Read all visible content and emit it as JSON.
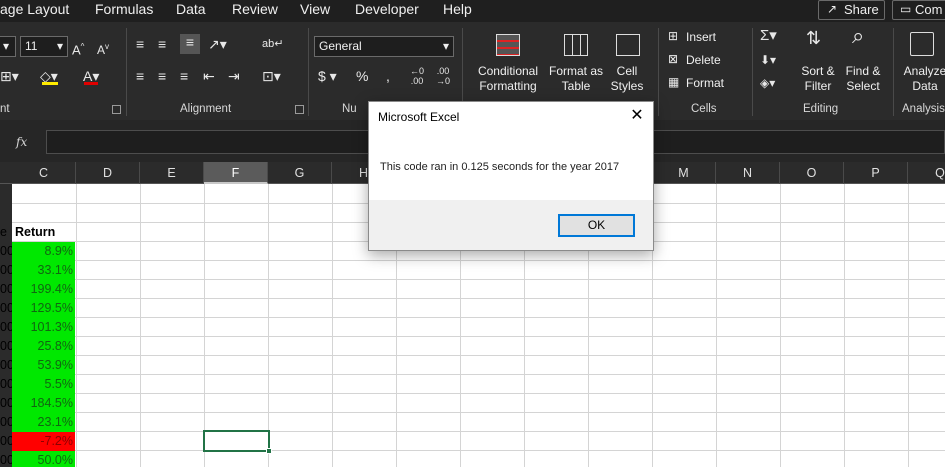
{
  "menu": {
    "items": [
      "age Layout",
      "Formulas",
      "Data",
      "Review",
      "View",
      "Developer",
      "Help"
    ],
    "share_label": "Share",
    "comments_label": "Com"
  },
  "ribbon": {
    "font_size": "11",
    "number_format": "General",
    "groups": {
      "font": "nt",
      "alignment": "Alignment",
      "number": "Nu",
      "cells": "Cells",
      "editing": "Editing",
      "analysis": "Analysis"
    },
    "conditional_formatting": [
      "Conditional",
      "Formatting"
    ],
    "format_as_table": [
      "Format as",
      "Table"
    ],
    "cell_styles": [
      "Cell",
      "Styles"
    ],
    "insert_label": "Insert",
    "delete_label": "Delete",
    "format_label": "Format",
    "sort_filter": [
      "Sort &",
      "Filter"
    ],
    "find_select": [
      "Find &",
      "Select"
    ],
    "analyze_data": [
      "Analyze",
      "Data"
    ]
  },
  "formula_bar": {
    "fx": "fx",
    "value": ""
  },
  "columns": [
    "C",
    "D",
    "E",
    "F",
    "G",
    "H",
    "M",
    "N",
    "O",
    "P",
    "Q"
  ],
  "selected_column": "F",
  "sheet": {
    "header_b_stub": "e",
    "header_c": "Return",
    "rows": [
      {
        "b": "00",
        "return": "8.9%",
        "status": "positive"
      },
      {
        "b": "00",
        "return": "33.1%",
        "status": "positive"
      },
      {
        "b": "00",
        "return": "199.4%",
        "status": "positive"
      },
      {
        "b": "00",
        "return": "129.5%",
        "status": "positive"
      },
      {
        "b": "00",
        "return": "101.3%",
        "status": "positive"
      },
      {
        "b": "00",
        "return": "25.8%",
        "status": "positive"
      },
      {
        "b": "00",
        "return": "53.9%",
        "status": "positive"
      },
      {
        "b": "00",
        "return": "5.5%",
        "status": "positive"
      },
      {
        "b": "00",
        "return": "184.5%",
        "status": "positive"
      },
      {
        "b": "00",
        "return": "23.1%",
        "status": "positive"
      },
      {
        "b": "00",
        "return": "-7.2%",
        "status": "negative"
      },
      {
        "b": "00",
        "return": "50.0%",
        "status": "positive"
      }
    ]
  },
  "dialog": {
    "title": "Microsoft Excel",
    "message": "This code ran in 0.125 seconds for the year 2017",
    "ok_label": "OK"
  },
  "colors": {
    "positive_fill": "#00e800",
    "negative_fill": "#ff0000",
    "selection_border": "#217346",
    "dialog_focus": "#0078d7"
  }
}
